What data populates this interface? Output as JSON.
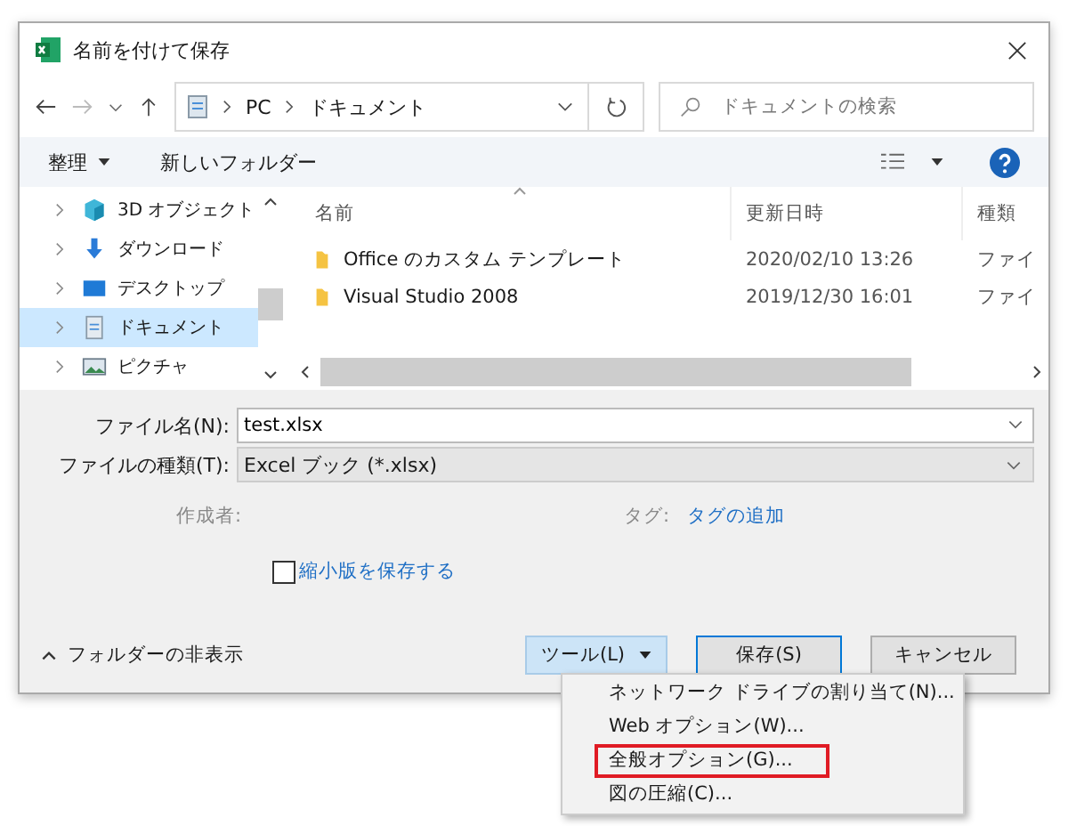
{
  "window": {
    "title": "名前を付けて保存"
  },
  "address": {
    "path": [
      "PC",
      "ドキュメント"
    ]
  },
  "search": {
    "placeholder": "ドキュメントの検索"
  },
  "toolbar": {
    "organize": "整理",
    "new_folder": "新しいフォルダー"
  },
  "nav_pane": [
    {
      "label": "3D オブジェクト",
      "kind": "cube",
      "selected": false
    },
    {
      "label": "ダウンロード",
      "kind": "download",
      "selected": false
    },
    {
      "label": "デスクトップ",
      "kind": "desktop",
      "selected": false
    },
    {
      "label": "ドキュメント",
      "kind": "document",
      "selected": true
    },
    {
      "label": "ピクチャ",
      "kind": "picture",
      "selected": false
    }
  ],
  "file_list": {
    "columns": [
      "名前",
      "更新日時",
      "種類"
    ],
    "rows": [
      {
        "name": "Office のカスタム テンプレート",
        "modified": "2020/02/10 13:26",
        "type": "ファイ"
      },
      {
        "name": "Visual Studio 2008",
        "modified": "2019/12/30 16:01",
        "type": "ファイ"
      }
    ]
  },
  "form": {
    "file_name": {
      "label": "ファイル名(N):",
      "value": "test.xlsx"
    },
    "file_type": {
      "label": "ファイルの種類(T):",
      "value": "Excel ブック (*.xlsx)"
    },
    "author": {
      "label": "作成者:"
    },
    "tags": {
      "label": "タグ:",
      "link": "タグの追加"
    },
    "thumbnail": {
      "label": "縮小版を保存する",
      "checked": false
    }
  },
  "footer": {
    "hide_folders": "フォルダーの非表示",
    "tools": {
      "label": "ツール(L)",
      "expanded": true
    },
    "save": "保存(S)",
    "cancel": "キャンセル"
  },
  "tools_menu": [
    {
      "label": "ネットワーク ドライブの割り当て(N)...",
      "marked": false
    },
    {
      "label": "Web オプション(W)...",
      "marked": false
    },
    {
      "label": "全般オプション(G)...",
      "marked": true
    },
    {
      "label": "図の圧縮(C)...",
      "marked": false
    }
  ]
}
